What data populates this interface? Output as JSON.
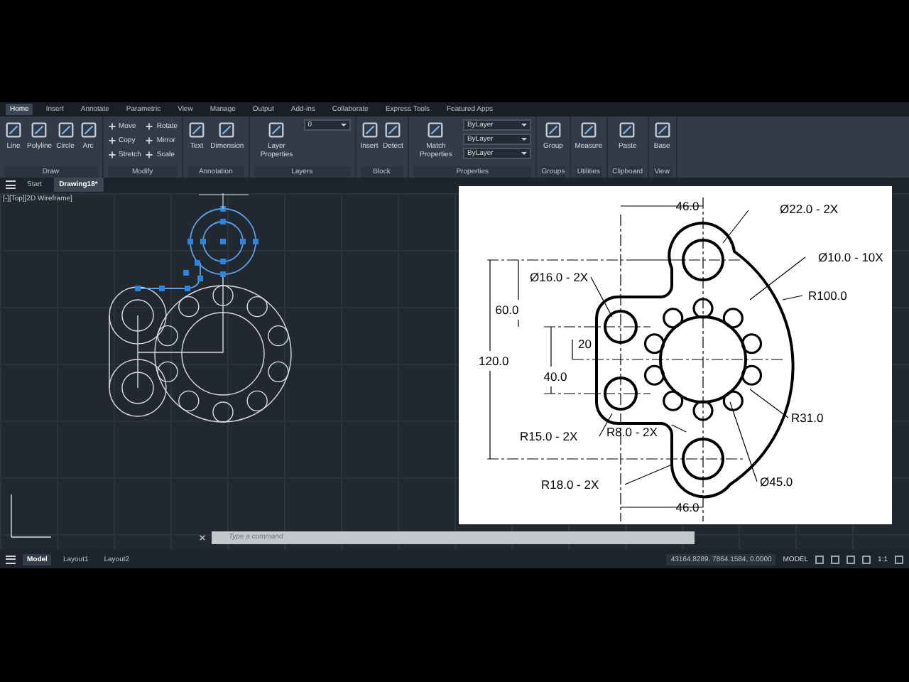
{
  "ribbon_tabs": [
    {
      "label": "Home",
      "selected": true
    },
    {
      "label": "Insert",
      "selected": false
    },
    {
      "label": "Annotate",
      "selected": false
    },
    {
      "label": "Parametric",
      "selected": false
    },
    {
      "label": "View",
      "selected": false
    },
    {
      "label": "Manage",
      "selected": false
    },
    {
      "label": "Output",
      "selected": false
    },
    {
      "label": "Add-ins",
      "selected": false
    },
    {
      "label": "Collaborate",
      "selected": false
    },
    {
      "label": "Express Tools",
      "selected": false
    },
    {
      "label": "Featured Apps",
      "selected": false
    }
  ],
  "ribbon_panels": [
    {
      "title": "Draw",
      "tools": [
        {
          "label": "Line",
          "kind": "large"
        },
        {
          "label": "Polyline",
          "kind": "large"
        },
        {
          "label": "Circle",
          "kind": "large"
        },
        {
          "label": "Arc",
          "kind": "large"
        }
      ]
    },
    {
      "title": "Modify",
      "tools": [
        {
          "label": "Move",
          "kind": "small"
        },
        {
          "label": "Copy",
          "kind": "small"
        },
        {
          "label": "Stretch",
          "kind": "small"
        },
        {
          "label": "Rotate",
          "kind": "small"
        },
        {
          "label": "Mirror",
          "kind": "small"
        },
        {
          "label": "Scale",
          "kind": "small"
        }
      ]
    },
    {
      "title": "Annotation",
      "tools": [
        {
          "label": "Text",
          "kind": "large"
        },
        {
          "label": "Dimension",
          "kind": "large"
        }
      ]
    },
    {
      "title": "Layers",
      "tools": [
        {
          "label": "Layer Properties",
          "kind": "large"
        },
        {
          "label": "0",
          "kind": "dropdown"
        }
      ]
    },
    {
      "title": "Block",
      "tools": [
        {
          "label": "Insert",
          "kind": "large"
        },
        {
          "label": "Detect",
          "kind": "large"
        }
      ]
    },
    {
      "title": "Properties",
      "tools": [
        {
          "label": "Match Properties",
          "kind": "large"
        },
        {
          "label": "ByLayer",
          "kind": "dropdown"
        },
        {
          "label": "ByLayer",
          "kind": "dropdown"
        },
        {
          "label": "ByLayer",
          "kind": "dropdown"
        }
      ]
    },
    {
      "title": "Groups",
      "tools": [
        {
          "label": "Group",
          "kind": "large"
        }
      ]
    },
    {
      "title": "Utilities",
      "tools": [
        {
          "label": "Measure",
          "kind": "large"
        }
      ]
    },
    {
      "title": "Clipboard",
      "tools": [
        {
          "label": "Paste",
          "kind": "large"
        }
      ]
    },
    {
      "title": "View",
      "tools": [
        {
          "label": "Base",
          "kind": "large"
        }
      ]
    }
  ],
  "file_tabs": [
    {
      "label": "Start",
      "selected": false
    },
    {
      "label": "Drawing18*",
      "selected": true
    }
  ],
  "viewport_label": "[-][Top][2D Wireframe]",
  "reference_drawing": {
    "labels": [
      "46.0",
      "Ø22.0 - 2X",
      "Ø10.0 - 10X",
      "Ø16.0 - 2X",
      "R100.0",
      "60.0",
      "20",
      "120.0",
      "40.0",
      "R15.0 - 2X",
      "R8.0 - 2X",
      "R31.0",
      "R18.0 - 2X",
      "Ø45.0",
      "46.0"
    ]
  },
  "command_line": {
    "placeholder": "Type a command"
  },
  "layout_tabs": [
    {
      "label": "Model",
      "selected": true
    },
    {
      "label": "Layout1",
      "selected": false
    },
    {
      "label": "Layout2",
      "selected": false
    }
  ],
  "status_bar": {
    "coordinates": "43164.8289, 7864.1584, 0.0000",
    "space": "MODEL",
    "scale": "1:1"
  }
}
